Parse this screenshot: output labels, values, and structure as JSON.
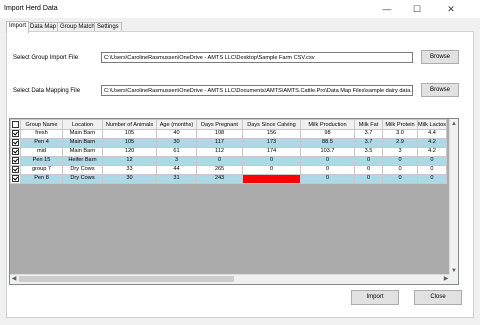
{
  "window": {
    "title": "Import Herd Data",
    "minimize": "—",
    "maximize": "☐",
    "close": "✕"
  },
  "tabs": [
    "Import",
    "Data Map",
    "Group Match",
    "Settings"
  ],
  "import": {
    "group_file_label": "Select Group Import File",
    "group_file_path": "C:\\Users\\CarolineRasmussen\\OneDrive - AMTS LLC\\Desktop\\Sample Farm CSV.csv",
    "mapping_file_label": "Select Data Mapping File",
    "mapping_file_path": "C:\\Users\\CarolineRasmussen\\OneDrive - AMTS LLC\\Documents\\AMTS\\AMTS.Cattle.Pro\\Data Map Files\\sample dairy data.ma",
    "browse_label": "Browse"
  },
  "grid": {
    "columns": [
      "",
      "Group Name",
      "Location",
      "Number of Animals",
      "Age (months)",
      "Days Pregnant",
      "Days Since Calving",
      "Milk Production",
      "Milk Fat",
      "Milk Protein",
      "Milk Lactos"
    ],
    "rows": [
      {
        "checked": true,
        "cells": [
          "fresh",
          "Main Barn",
          "105",
          "40",
          "108",
          "156",
          "98",
          "3.7",
          "3.0",
          "4.4"
        ]
      },
      {
        "checked": true,
        "cells": [
          "Pen 4",
          "Main Barn",
          "105",
          "30",
          "117",
          "173",
          "88.5",
          "3.7",
          "2.9",
          "4.2"
        ]
      },
      {
        "checked": true,
        "cells": [
          "mid",
          "Main Barn",
          "120",
          "61",
          "112",
          "174",
          "103.7",
          "3.5",
          "3",
          "4.2"
        ]
      },
      {
        "checked": true,
        "cells": [
          "Pen 15",
          "Heifer Barn",
          "12",
          "3",
          "0",
          "0",
          "0",
          "0",
          "0",
          "0"
        ]
      },
      {
        "checked": true,
        "cells": [
          "group 7",
          "Dry Cows",
          "33",
          "44",
          "265",
          "0",
          "0",
          "0",
          "0",
          "0"
        ]
      },
      {
        "checked": true,
        "cells": [
          "Pen 8",
          "Dry Cows",
          "30",
          "31",
          "243",
          "-961",
          "0",
          "0",
          "0",
          "0"
        ]
      }
    ],
    "highlight_color": "#ff0000",
    "alt_row_color": "#add8e6"
  },
  "footer": {
    "import_label": "Import",
    "close_label": "Close"
  }
}
